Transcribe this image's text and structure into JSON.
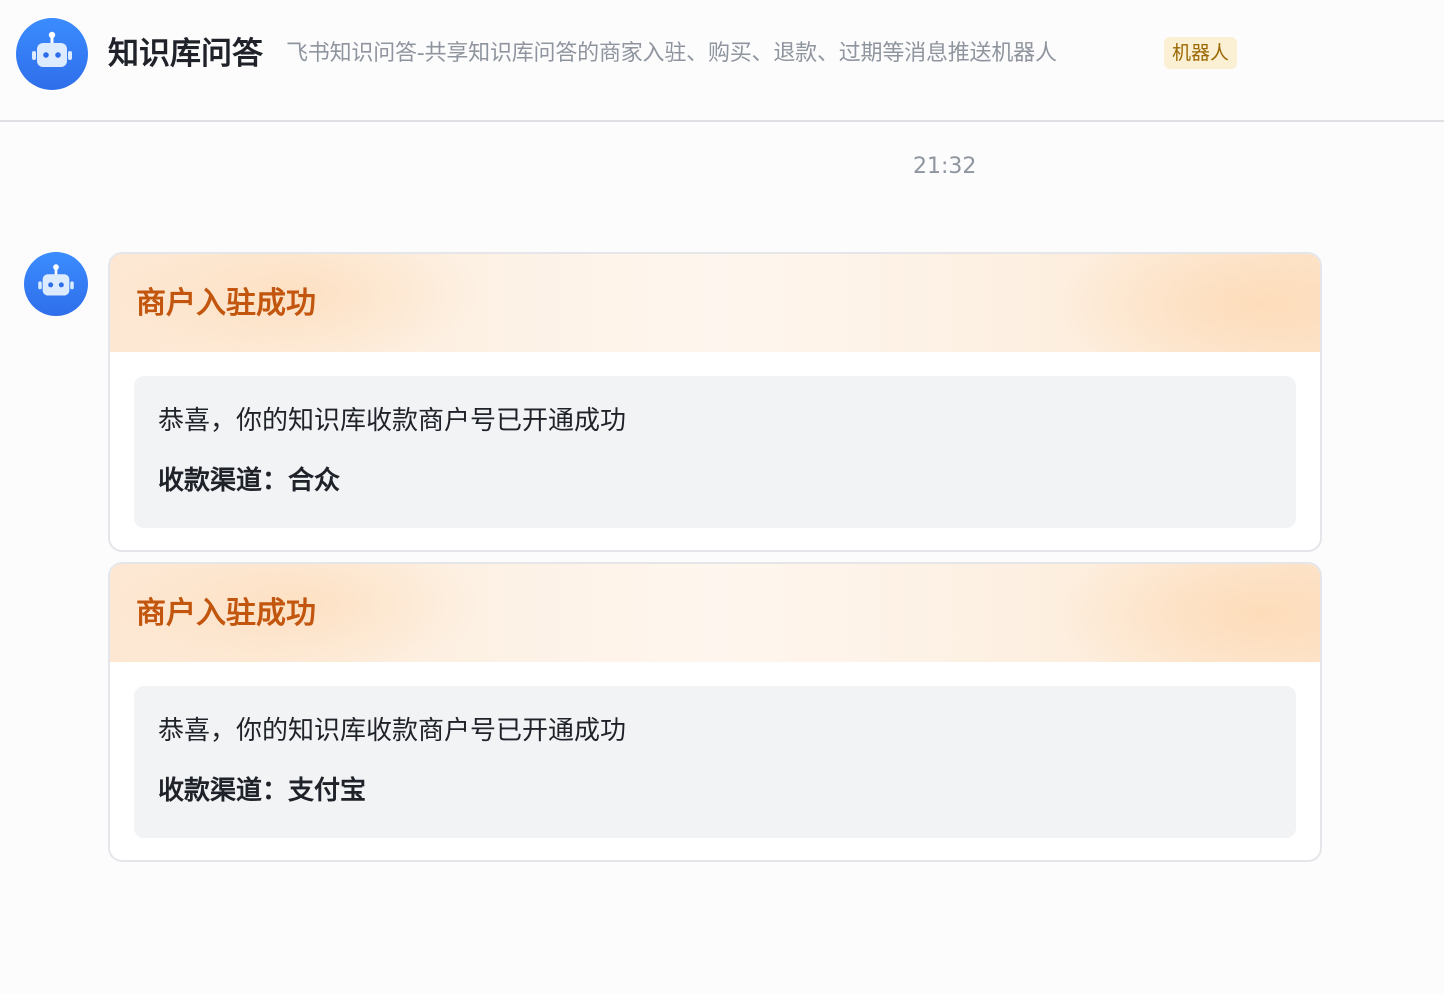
{
  "header": {
    "title": "知识库问答",
    "description": "飞书知识问答-共享知识库问答的商家入驻、购买、退款、过期等消息推送机器人",
    "badge": "机器人",
    "avatar_icon": "robot-icon"
  },
  "chat": {
    "timestamp": "21:32",
    "sender_avatar_icon": "robot-icon",
    "cards": [
      {
        "title": "商户入驻成功",
        "body_line": "恭喜，你的知识库收款商户号已开通成功",
        "channel_line": "收款渠道：合众"
      },
      {
        "title": "商户入驻成功",
        "body_line": "恭喜，你的知识库收款商户号已开通成功",
        "channel_line": "收款渠道：支付宝"
      }
    ]
  },
  "colors": {
    "avatar_blue": "#2f6eea",
    "card_title": "#c2560e",
    "badge_bg": "#fbf0d4",
    "badge_text": "#9a6700",
    "body_bg": "#f2f3f5"
  }
}
